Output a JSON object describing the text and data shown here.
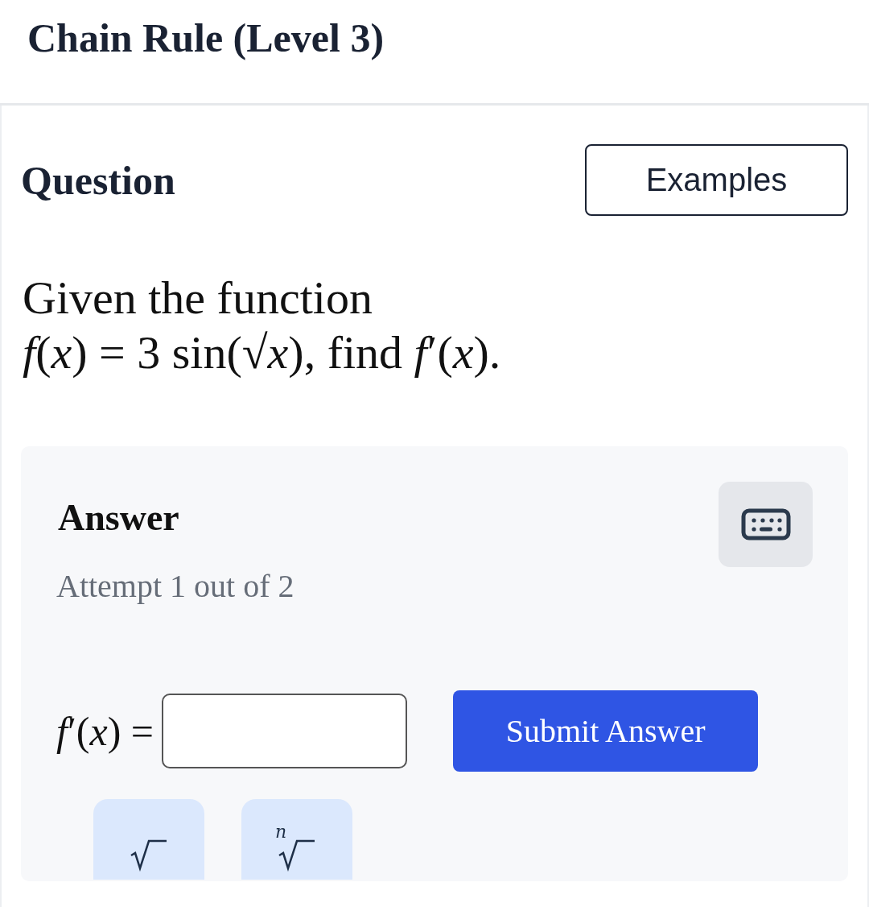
{
  "header": {
    "title": "Chain Rule (Level 3)"
  },
  "question": {
    "heading": "Question",
    "examples_button": "Examples",
    "text": "Given the function\n*f*(*x*) = 3 sin(√*x*), find *f*′(*x*)."
  },
  "answer": {
    "heading": "Answer",
    "attempt": "Attempt 1 out of 2",
    "label": "*f*′(*x*) =",
    "submit_button": "Submit Answer",
    "keys": [
      {
        "kind": "sqrt"
      },
      {
        "kind": "nth_root",
        "index": "n"
      }
    ]
  }
}
